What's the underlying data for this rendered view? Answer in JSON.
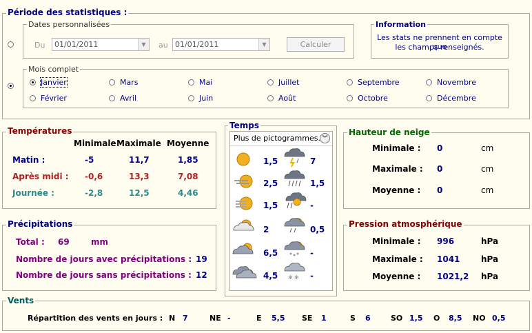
{
  "periode": {
    "title": "Période des statistiques :",
    "dates_title": "Dates personnalisées",
    "du_label": "Du",
    "du_value": "01/01/2011",
    "au_label": "au",
    "au_value": "01/01/2011",
    "calc_label": "Calculer",
    "mois_title": "Mois complet",
    "months": [
      "Janvier",
      "Mars",
      "Mai",
      "Juillet",
      "Septembre",
      "Novembre",
      "Février",
      "Avril",
      "Juin",
      "Août",
      "Octobre",
      "Décembre"
    ],
    "selected_month": "Janvier"
  },
  "info": {
    "title": "Information",
    "line1": "Les stats ne prennent en compte que",
    "line2": "les champs renseignés."
  },
  "temperatures": {
    "title": "Températures",
    "headers": [
      "Minimale",
      "Maximale",
      "Moyenne"
    ],
    "rows": [
      {
        "label": "Matin :",
        "min": "-5",
        "max": "11,7",
        "moy": "1,85",
        "color": "#00008b"
      },
      {
        "label": "Après midi :",
        "min": "-0,6",
        "max": "13,3",
        "moy": "7,08",
        "color": "#b22222"
      },
      {
        "label": "Journée :",
        "min": "-2,8",
        "max": "12,5",
        "moy": "4,46",
        "color": "#2e8b8b"
      }
    ]
  },
  "temps": {
    "title": "Temps",
    "dropdown": "Plus de pictogrammes...",
    "left_values": [
      "1,5",
      "2,5",
      "1,5",
      "2",
      "6,5",
      "4,5"
    ],
    "right_values": [
      "7",
      "1,5",
      "-",
      "0,5",
      "-",
      "-"
    ],
    "left_icons": [
      "sun-icon",
      "sun-fog-icon",
      "sun-haze-icon",
      "partly-cloudy-icon",
      "mostly-cloudy-icon",
      "cloudy-icon"
    ],
    "right_icons": [
      "thunderstorm-icon",
      "rain-cloud-icon",
      "storm-rain-icon",
      "shower-cloud-icon",
      "hail-cloud-icon",
      "snow-cloud-icon"
    ]
  },
  "neige": {
    "title": "Hauteur de neige",
    "rows": [
      {
        "label": "Minimale :",
        "value": "0",
        "unit": "cm"
      },
      {
        "label": "Maximale :",
        "value": "0",
        "unit": "cm"
      },
      {
        "label": "Moyenne :",
        "value": "0",
        "unit": "cm"
      }
    ]
  },
  "precip": {
    "title": "Précipitations",
    "total_label": "Total :",
    "total_value": "69",
    "total_unit": "mm",
    "avec_label": "Nombre de jours avec précipitations :",
    "avec_value": "19",
    "sans_label": "Nombre de jours sans précipitations :",
    "sans_value": "12"
  },
  "pression": {
    "title": "Pression atmosphérique",
    "rows": [
      {
        "label": "Minimale :",
        "value": "996",
        "unit": "hPa"
      },
      {
        "label": "Maximale :",
        "value": "1041",
        "unit": "hPa"
      },
      {
        "label": "Moyenne :",
        "value": "1021,2",
        "unit": "hPa"
      }
    ]
  },
  "vents": {
    "title": "Vents",
    "label": "Répartition des vents en jours :",
    "dirs": [
      {
        "d": "N",
        "v": "7"
      },
      {
        "d": "NE",
        "v": "-"
      },
      {
        "d": "E",
        "v": "5,5"
      },
      {
        "d": "SE",
        "v": "1"
      },
      {
        "d": "S",
        "v": "6"
      },
      {
        "d": "SO",
        "v": "1,5"
      },
      {
        "d": "O",
        "v": "8,5"
      },
      {
        "d": "NO",
        "v": "0,5"
      }
    ]
  },
  "colors": {
    "navy": "#000080",
    "dark_red": "#8b0000",
    "green": "#006400",
    "purple": "#800080",
    "teal": "#006060",
    "background": "#fffdf0"
  }
}
